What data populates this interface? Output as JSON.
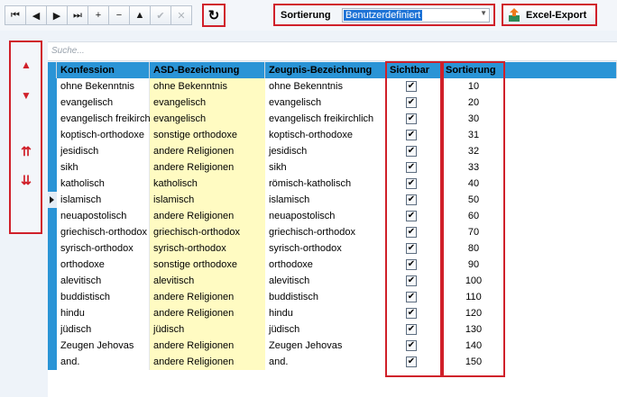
{
  "toolbar": {
    "nav_buttons": [
      {
        "glyph": "⏮",
        "icon": "first-record-icon",
        "enabled": true
      },
      {
        "glyph": "◀",
        "icon": "previous-record-icon",
        "enabled": true
      },
      {
        "glyph": "▶",
        "icon": "next-record-icon",
        "enabled": true
      },
      {
        "glyph": "⏭",
        "icon": "last-record-icon",
        "enabled": true
      },
      {
        "glyph": "+",
        "icon": "add-icon",
        "enabled": true
      },
      {
        "glyph": "−",
        "icon": "remove-icon",
        "enabled": true
      },
      {
        "glyph": "▲",
        "icon": "edit-icon",
        "enabled": true
      },
      {
        "glyph": "✔",
        "icon": "save-icon",
        "enabled": false
      },
      {
        "glyph": "✕",
        "icon": "cancel-icon",
        "enabled": false
      }
    ],
    "refresh_glyph": "↻",
    "sort_label": "Sortierung",
    "sort_value": "Benutzerdefiniert",
    "excel_label": "Excel-Export"
  },
  "sidebar": {
    "move_up": "▲",
    "move_down": "▼",
    "move_top": "⇈",
    "move_bottom": "⇊"
  },
  "search": {
    "placeholder": "Suche..."
  },
  "grid": {
    "columns": [
      "Konfession",
      "ASD-Bezeichnung",
      "Zeugnis-Bezeichnung",
      "Sichtbar",
      "Sortierung"
    ],
    "current_row": 7,
    "rows": [
      {
        "konfession": "ohne Bekenntnis",
        "asd": "ohne Bekenntnis",
        "zeugnis": "ohne Bekenntnis",
        "sichtbar": true,
        "sortierung": "10"
      },
      {
        "konfession": "evangelisch",
        "asd": "evangelisch",
        "zeugnis": "evangelisch",
        "sichtbar": true,
        "sortierung": "20"
      },
      {
        "konfession": "evangelisch freikirchlich",
        "asd": "evangelisch",
        "zeugnis": "evangelisch freikirchlich",
        "sichtbar": true,
        "sortierung": "30"
      },
      {
        "konfession": "koptisch-orthodoxe",
        "asd": "sonstige orthodoxe",
        "zeugnis": "koptisch-orthodoxe",
        "sichtbar": true,
        "sortierung": "31"
      },
      {
        "konfession": "jesidisch",
        "asd": "andere Religionen",
        "zeugnis": "jesidisch",
        "sichtbar": true,
        "sortierung": "32"
      },
      {
        "konfession": "sikh",
        "asd": "andere Religionen",
        "zeugnis": "sikh",
        "sichtbar": true,
        "sortierung": "33"
      },
      {
        "konfession": "katholisch",
        "asd": "katholisch",
        "zeugnis": "römisch-katholisch",
        "sichtbar": true,
        "sortierung": "40"
      },
      {
        "konfession": "islamisch",
        "asd": "islamisch",
        "zeugnis": "islamisch",
        "sichtbar": true,
        "sortierung": "50"
      },
      {
        "konfession": "neuapostolisch",
        "asd": "andere Religionen",
        "zeugnis": "neuapostolisch",
        "sichtbar": true,
        "sortierung": "60"
      },
      {
        "konfession": "griechisch-orthodox",
        "asd": "griechisch-orthodox",
        "zeugnis": "griechisch-orthodox",
        "sichtbar": true,
        "sortierung": "70"
      },
      {
        "konfession": "syrisch-orthodox",
        "asd": "syrisch-orthodox",
        "zeugnis": "syrisch-orthodox",
        "sichtbar": true,
        "sortierung": "80"
      },
      {
        "konfession": "orthodoxe",
        "asd": "sonstige orthodoxe",
        "zeugnis": "orthodoxe",
        "sichtbar": true,
        "sortierung": "90"
      },
      {
        "konfession": "alevitisch",
        "asd": "alevitisch",
        "zeugnis": "alevitisch",
        "sichtbar": true,
        "sortierung": "100"
      },
      {
        "konfession": "buddistisch",
        "asd": "andere Religionen",
        "zeugnis": "buddistisch",
        "sichtbar": true,
        "sortierung": "110"
      },
      {
        "konfession": "hindu",
        "asd": "andere Religionen",
        "zeugnis": "hindu",
        "sichtbar": true,
        "sortierung": "120"
      },
      {
        "konfession": "jüdisch",
        "asd": "jüdisch",
        "zeugnis": "jüdisch",
        "sichtbar": true,
        "sortierung": "130"
      },
      {
        "konfession": "Zeugen Jehovas",
        "asd": "andere Religionen",
        "zeugnis": "Zeugen Jehovas",
        "sichtbar": true,
        "sortierung": "140"
      },
      {
        "konfession": "and.",
        "asd": "andere Religionen",
        "zeugnis": "and.",
        "sichtbar": true,
        "sortierung": "150"
      }
    ]
  },
  "colors": {
    "accent": "#2a94d6",
    "highlight": "#d0202a",
    "asd_cell": "#fffbc2"
  }
}
